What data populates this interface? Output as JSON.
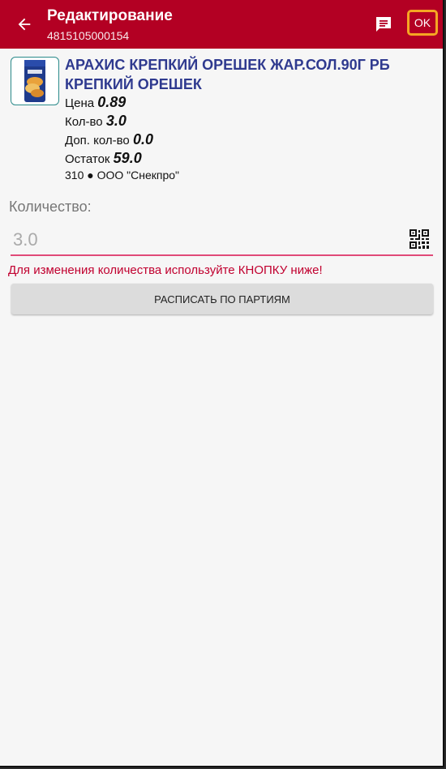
{
  "appbar": {
    "title": "Редактирование",
    "subtitle": "4815105000154",
    "ok_label": "OK"
  },
  "product": {
    "name": "АРАХИС КРЕПКИЙ ОРЕШЕК ЖАР.СОЛ.90Г РБ КРЕПКИЙ ОРЕШЕК",
    "price_label": "Цена",
    "price_value": "0.89",
    "qty_label": "Кол-во",
    "qty_value": "3.0",
    "extra_qty_label": "Доп. кол-во",
    "extra_qty_value": "0.0",
    "stock_label": "Остаток",
    "stock_value": "59.0",
    "supplier": "310 ● ООО \"Снекпро\""
  },
  "quantity": {
    "label": "Количество:",
    "placeholder": "3.0"
  },
  "warning": "Для изменения количества используйте КНОПКУ ниже!",
  "batch_button": "РАСПИСАТЬ ПО ПАРТИЯМ",
  "colors": {
    "appbar": "#b30023",
    "ok_highlight": "#f5a623",
    "product_name": "#2f3a8f",
    "warning": "#c1002f",
    "underline": "#e04a78"
  },
  "icons": {
    "back": "arrow-back-icon",
    "comment": "comment-icon",
    "scan": "qr-code-icon"
  }
}
